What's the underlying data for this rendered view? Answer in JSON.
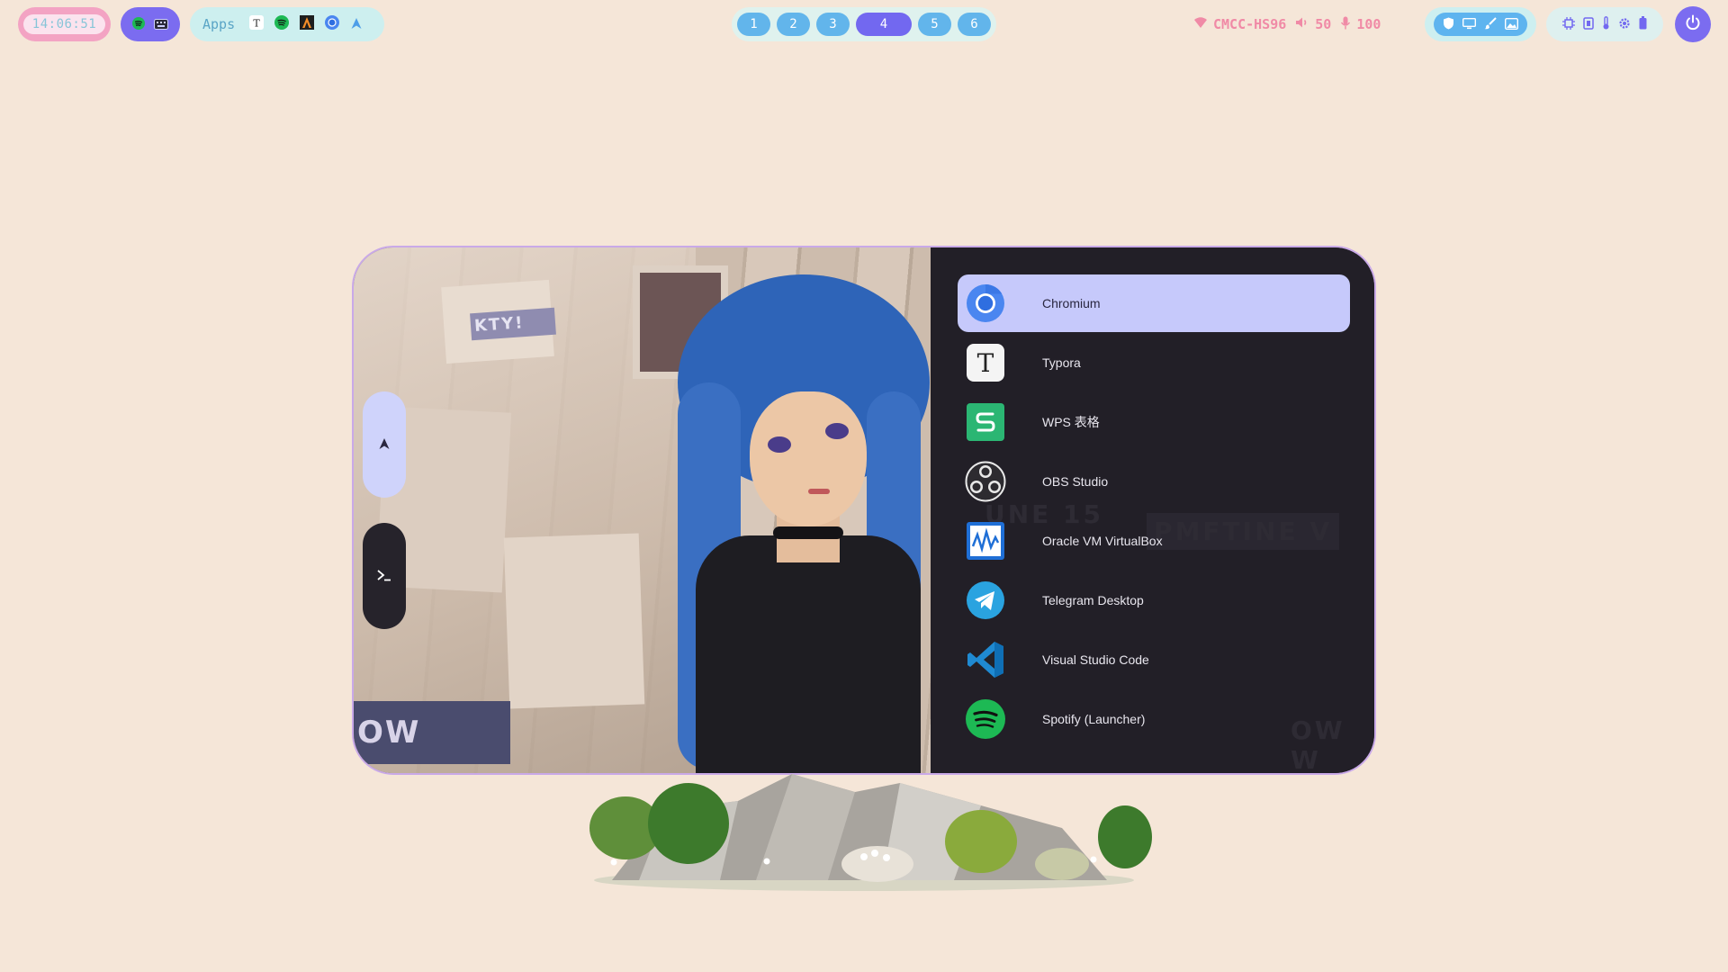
{
  "topbar": {
    "clock": "14:06:51",
    "apps_label": "Apps",
    "workspaces": [
      "1",
      "2",
      "3",
      "4",
      "5",
      "6"
    ],
    "active_workspace": "4",
    "network": "CMCC-HS96",
    "volume": "50",
    "mic": "100"
  },
  "launcher": {
    "selected": "Chromium",
    "items": [
      {
        "name": "Chromium",
        "icon": "chromium-icon"
      },
      {
        "name": "Typora",
        "icon": "typora-icon"
      },
      {
        "name": "WPS 表格",
        "icon": "wps-spreadsheet-icon"
      },
      {
        "name": "OBS Studio",
        "icon": "obs-icon"
      },
      {
        "name": "Oracle VM VirtualBox",
        "icon": "virtualbox-icon"
      },
      {
        "name": "Telegram Desktop",
        "icon": "telegram-icon"
      },
      {
        "name": "Visual Studio Code",
        "icon": "vscode-icon"
      },
      {
        "name": "Spotify (Launcher)",
        "icon": "spotify-icon"
      }
    ],
    "art_banner_text": "OW WAT"
  },
  "colors": {
    "background": "#f5e6d8",
    "accent_purple": "#7b6cf0",
    "accent_blue": "#62b5eb",
    "status_pink": "#f08aa6",
    "selection": "#c6c9fb"
  }
}
